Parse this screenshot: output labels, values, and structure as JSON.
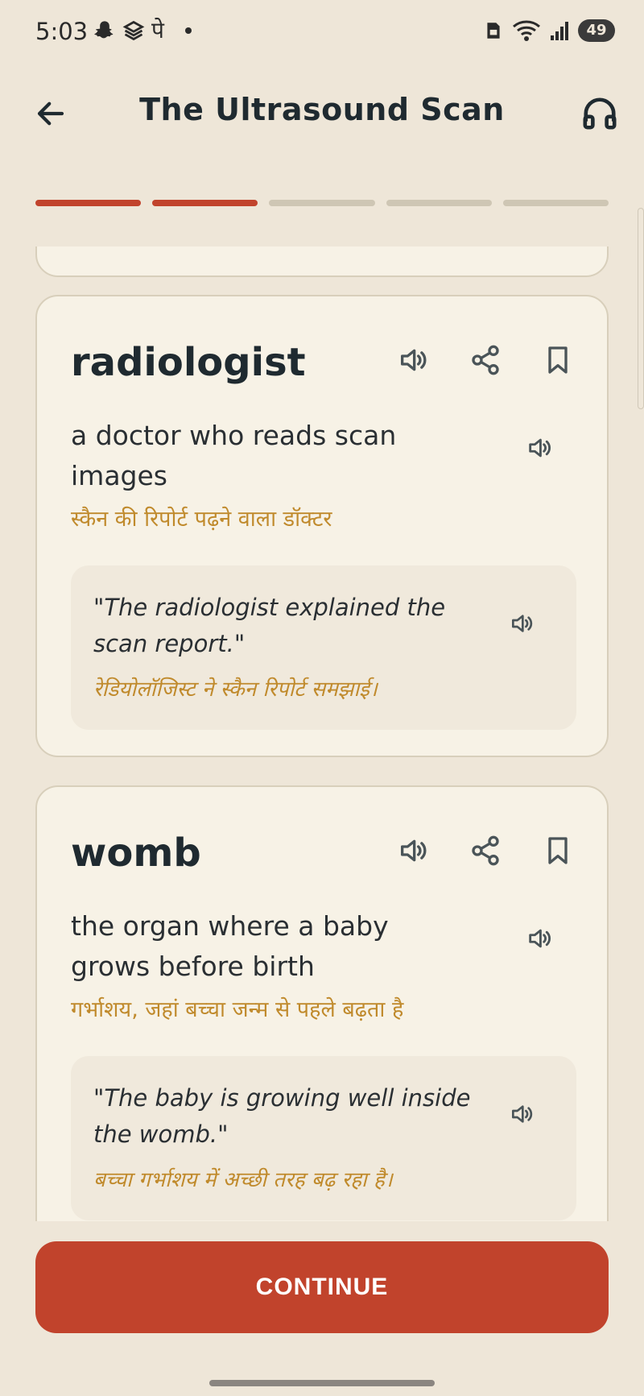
{
  "status_bar": {
    "time": "5:03",
    "left_icons": [
      "snapchat-icon",
      "stack-icon",
      "pe-text",
      "dot"
    ],
    "pe_text": "पे",
    "battery": "49"
  },
  "header": {
    "title": "The Ultrasound Scan",
    "back_icon": "arrow-left-icon",
    "audio_icon": "headphones-icon"
  },
  "progress": {
    "total_steps": 5,
    "completed_steps": 2,
    "active_color": "#c1432c",
    "inactive_color": "#cec6b4"
  },
  "cards": [
    {
      "word": "radiologist",
      "definition": "a doctor who reads scan images",
      "definition_hi": "स्कैन की रिपोर्ट पढ़ने वाला डॉक्टर",
      "example": "\"The radiologist explained the scan report.\"",
      "example_hi": "रेडियोलॉजिस्ट ने स्कैन रिपोर्ट समझाई।"
    },
    {
      "word": "womb",
      "definition": "the organ where a baby grows before birth",
      "definition_hi": "गर्भाशय, जहां बच्चा जन्म से पहले बढ़ता है",
      "example": "\"The baby is growing well inside the womb.\"",
      "example_hi": "बच्चा गर्भाशय में अच्छी तरह बढ़ रहा है।"
    }
  ],
  "continue_label": "CONTINUE",
  "colors": {
    "background": "#eee6d8",
    "card": "#f7f2e6",
    "accent": "#c1432c",
    "hindi_text": "#c08a2c"
  }
}
